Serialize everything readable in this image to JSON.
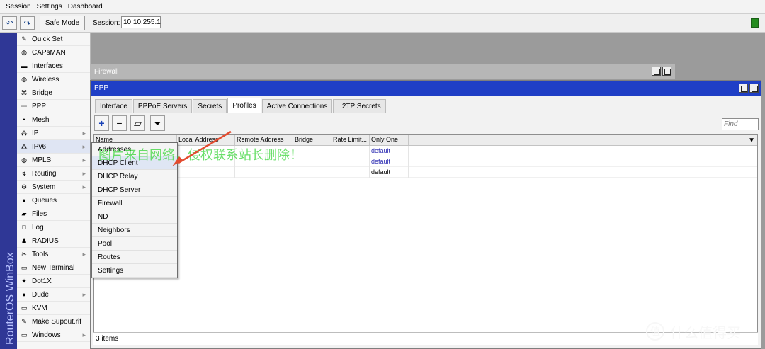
{
  "menubar": {
    "items": [
      "Session",
      "Settings",
      "Dashboard"
    ]
  },
  "toolbar": {
    "undo_icon": "↶",
    "redo_icon": "↷",
    "safe_mode": "Safe Mode",
    "session_label": "Session:",
    "session_value": "10.10.255.1"
  },
  "brand": "RouterOS WinBox",
  "sidebar": {
    "items": [
      {
        "label": "Quick Set",
        "icon": "✎",
        "arrow": ""
      },
      {
        "label": "CAPsMAN",
        "icon": "◍",
        "arrow": ""
      },
      {
        "label": "Interfaces",
        "icon": "▬",
        "arrow": ""
      },
      {
        "label": "Wireless",
        "icon": "◍",
        "arrow": ""
      },
      {
        "label": "Bridge",
        "icon": "⌘",
        "arrow": ""
      },
      {
        "label": "PPP",
        "icon": "⋯",
        "arrow": ""
      },
      {
        "label": "Mesh",
        "icon": "•",
        "arrow": ""
      },
      {
        "label": "IP",
        "icon": "⁂",
        "arrow": "▸"
      },
      {
        "label": "IPv6",
        "icon": "⁂",
        "arrow": "▸"
      },
      {
        "label": "MPLS",
        "icon": "◍",
        "arrow": "▸"
      },
      {
        "label": "Routing",
        "icon": "↯",
        "arrow": "▸"
      },
      {
        "label": "System",
        "icon": "⚙",
        "arrow": "▸"
      },
      {
        "label": "Queues",
        "icon": "●",
        "arrow": ""
      },
      {
        "label": "Files",
        "icon": "▰",
        "arrow": ""
      },
      {
        "label": "Log",
        "icon": "□",
        "arrow": ""
      },
      {
        "label": "RADIUS",
        "icon": "♟",
        "arrow": ""
      },
      {
        "label": "Tools",
        "icon": "✂",
        "arrow": "▸"
      },
      {
        "label": "New Terminal",
        "icon": "▭",
        "arrow": ""
      },
      {
        "label": "Dot1X",
        "icon": "✦",
        "arrow": ""
      },
      {
        "label": "Dude",
        "icon": "●",
        "arrow": "▸"
      },
      {
        "label": "KVM",
        "icon": "▭",
        "arrow": ""
      },
      {
        "label": "Make Supout.rif",
        "icon": "✎",
        "arrow": ""
      },
      {
        "label": "Windows",
        "icon": "▭",
        "arrow": "▸"
      }
    ]
  },
  "firewall_window": {
    "title": "Firewall"
  },
  "ppp_window": {
    "title": "PPP",
    "tabs": [
      "Interface",
      "PPPoE Servers",
      "Secrets",
      "Profiles",
      "Active Connections",
      "L2TP Secrets"
    ],
    "active_tab": "Profiles",
    "find_placeholder": "Find",
    "columns": [
      "Name",
      "Local Address",
      "Remote Address",
      "Bridge",
      "Rate Limit...",
      "Only One"
    ],
    "rows": [
      {
        "only_one": "default",
        "style": "link"
      },
      {
        "only_one": "default",
        "style": "link"
      },
      {
        "only_one": "default",
        "style": "plain"
      }
    ],
    "status": "3 items"
  },
  "context_menu": {
    "items": [
      "Addresses",
      "DHCP Client",
      "DHCP Relay",
      "DHCP Server",
      "Firewall",
      "ND",
      "Neighbors",
      "Pool",
      "Routes",
      "Settings"
    ]
  },
  "watermark": "图片来自网络，侵权联系站长删除！",
  "logo_text": "什么值得买",
  "logo_icon": "值",
  "colors": {
    "brand_bar": "#2f3796",
    "ppp_title": "#1f3fc6",
    "status_led": "#248c1f",
    "arrow": "#e34b2f"
  }
}
